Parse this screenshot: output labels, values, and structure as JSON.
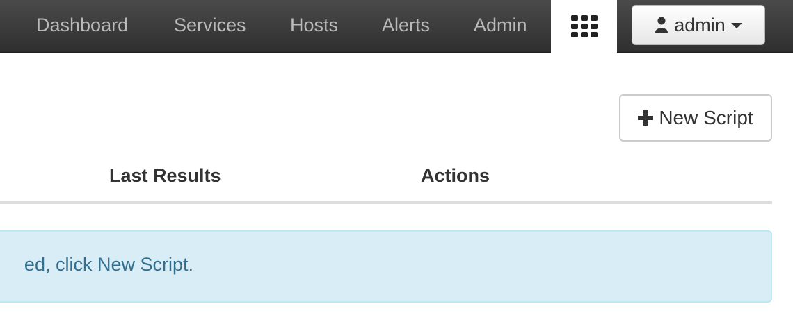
{
  "navbar": {
    "items": [
      {
        "label": "Dashboard"
      },
      {
        "label": "Services"
      },
      {
        "label": "Hosts"
      },
      {
        "label": "Alerts"
      },
      {
        "label": "Admin"
      }
    ],
    "grid_icon": "apps-grid-icon",
    "user": {
      "label": "admin",
      "icon": "user-icon"
    }
  },
  "toolbar": {
    "new_script_label": "New Script",
    "new_script_icon": "plus-icon"
  },
  "table": {
    "headers": [
      "Last Results",
      "Actions"
    ]
  },
  "alert": {
    "text": "ed, click New Script."
  },
  "colors": {
    "navbar_bg": "#3b3b3b",
    "nav_text": "#b9b9b9",
    "alert_bg": "#d9edf7",
    "alert_border": "#bce8f1",
    "alert_text": "#31708f"
  }
}
